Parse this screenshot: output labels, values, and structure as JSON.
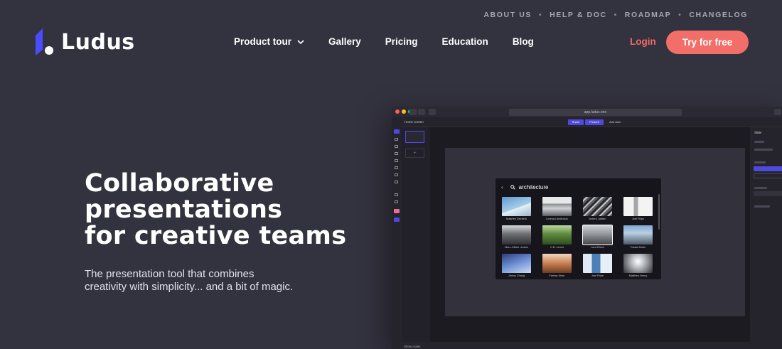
{
  "top_links": [
    "ABOUT US",
    "HELP & DOC",
    "ROADMAP",
    "CHANGELOG"
  ],
  "logo_text": "Ludus",
  "nav": [
    {
      "label": "Product tour",
      "has_dropdown": true
    },
    {
      "label": "Gallery"
    },
    {
      "label": "Pricing"
    },
    {
      "label": "Education"
    },
    {
      "label": "Blog"
    }
  ],
  "login_label": "Login",
  "cta_label": "Try for free",
  "hero": {
    "title_lines": [
      "Collaborative",
      "presentations",
      "for creative teams"
    ],
    "subtitle": "The presentation tool that combines creativity with simplicity... and a bit of magic."
  },
  "app": {
    "url": "app.ludus.one",
    "share_label": "Share",
    "present_label": "Present",
    "add_slide_label": "Add slide",
    "back_label": "Home screen",
    "bottom_label": "Show notes",
    "right_panel_title": "Slide",
    "search": {
      "query": "architecture",
      "results": [
        {
          "caption": "Maarten Deckers"
        },
        {
          "caption": "Lorenzo Ambrosio"
        },
        {
          "caption": "Ardero Jalilian"
        },
        {
          "caption": "Joel Filipe"
        },
        {
          "caption": "Marc-Olivier Jodoin"
        },
        {
          "caption": "C.B. Lenoir"
        },
        {
          "caption": "Luca Bravo"
        },
        {
          "caption": "Tobias Keller"
        },
        {
          "caption": "Jimmy Chang"
        },
        {
          "caption": "Farhan Khan"
        },
        {
          "caption": "Joel Filipe"
        },
        {
          "caption": "Matthew Henry"
        }
      ]
    }
  },
  "colors": {
    "background": "#33323f",
    "accent_coral": "#f26f69",
    "accent_purple": "#4f49e0",
    "logo_blue": "#4b4bff"
  }
}
